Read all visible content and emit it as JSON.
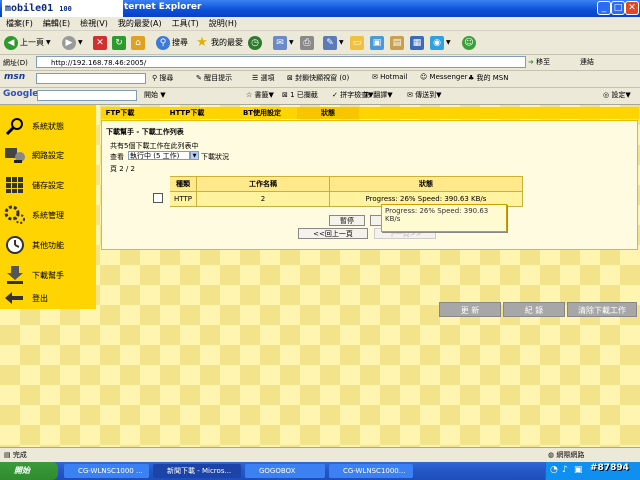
{
  "window": {
    "title": "ternet Explorer",
    "logo_text": "mobile01",
    "logo_badge": "100"
  },
  "menu": [
    "檔案(F)",
    "編輯(E)",
    "檢視(V)",
    "我的最愛(A)",
    "工具(T)",
    "說明(H)"
  ],
  "toolbar": {
    "back": "上一頁",
    "search": "搜尋",
    "favorites": "我的最愛"
  },
  "address": {
    "label": "網址(D)",
    "url": "http://192.168.78.46:2005/",
    "go": "移至",
    "links": "連結"
  },
  "msnbar": {
    "brand": "msn",
    "search": "搜尋",
    "highlight": "醒目提示",
    "options": "選項",
    "popup": "封鎖快顯視窗 (0)",
    "hotmail": "Hotmail",
    "messenger": "Messenger",
    "mymsn": "我的 MSN"
  },
  "googlebar": {
    "brand": "Google",
    "start": "開始",
    "bookmarks": "書籤",
    "blocked": "1 已攔截",
    "spell": "拼字檢查",
    "translate": "翻譯",
    "sendto": "傳送到",
    "settings": "設定"
  },
  "sidebar": {
    "items": [
      {
        "label": "系統狀態"
      },
      {
        "label": "網路設定"
      },
      {
        "label": "儲存設定"
      },
      {
        "label": "系統管理"
      },
      {
        "label": "其他功能"
      },
      {
        "label": "下載幫手"
      },
      {
        "label": "登出"
      }
    ]
  },
  "tabs": [
    {
      "label": "FTP下載"
    },
    {
      "label": "HTTP下載"
    },
    {
      "label": "BT使用設定"
    },
    {
      "label": "狀態"
    }
  ],
  "panel": {
    "heading": "下載幫手 - 下載工作列表",
    "summary": "共有5個下載工作在此列表中",
    "view_label": "查看",
    "view_select": "執行中 (5 工作)",
    "view_suffix": "下載狀況",
    "page": "頁 2 / 2",
    "columns": [
      "種類",
      "工作名稱",
      "狀態"
    ],
    "rows": [
      {
        "type": "HTTP",
        "name": "2",
        "status": "Progress: 26% Speed: 390.63 KB/s"
      }
    ],
    "pause_button": "暫停",
    "prev_button": "<<回上一頁",
    "next_button": "下一頁>>",
    "tooltip": "Progress: 26% Speed: 390.63 KB/s"
  },
  "actions": {
    "refresh": "更 新",
    "log": "紀 錄",
    "clear": "清除下載工作"
  },
  "status": {
    "left": "完成",
    "right": "網際網路"
  },
  "taskbar": {
    "start": "開始",
    "tasks": [
      {
        "label": "CG-WLNSC1000 ..."
      },
      {
        "label": "新聞下載 - Micros..."
      },
      {
        "label": "GOGOBOX"
      },
      {
        "label": "CG-WLNSC1000..."
      }
    ],
    "watermark": "#87894"
  }
}
